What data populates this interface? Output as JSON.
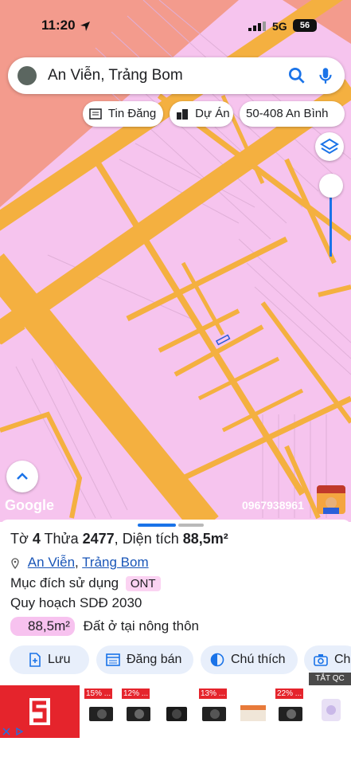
{
  "status": {
    "time": "11:20",
    "network": "5G",
    "battery": "56"
  },
  "search": {
    "query": "An Viễn, Trảng Bom"
  },
  "chips": [
    {
      "label": "Tin Đăng",
      "icon": "newspaper-icon"
    },
    {
      "label": "Dự Án",
      "icon": "buildings-icon"
    },
    {
      "label": "50-408 An Bình",
      "icon": ""
    }
  ],
  "map": {
    "attribution": "Google",
    "phone": "0967938961"
  },
  "parcel": {
    "to_label": "Tờ",
    "to": "4",
    "thua_label": "Thửa",
    "thua": "2477",
    "area_label": "Diện tích",
    "area": "88,5m²",
    "commune": "An Viễn",
    "district": "Trảng Bom",
    "purpose_label": "Mục đích sử dụng",
    "purpose_code": "ONT",
    "plan_label": "Quy hoạch SDĐ 2030",
    "plan_area": "88,5m²",
    "plan_type": "Đất ở tại nông thôn"
  },
  "actions": [
    {
      "label": "Lưu",
      "icon": "save-icon"
    },
    {
      "label": "Đăng bán",
      "icon": "post-sale-icon"
    },
    {
      "label": "Chú thích",
      "icon": "legend-icon"
    },
    {
      "label": "Ch",
      "icon": "camera-icon"
    }
  ],
  "ad": {
    "close_label": "TẮT QC",
    "discounts": [
      "15% ...",
      "12% ...",
      "13% ...",
      "22% ..."
    ]
  },
  "colors": {
    "parcel": "#f6c4ee",
    "road": "#f4b040",
    "residential": "#f39b8d",
    "accent": "#1a73e8"
  }
}
